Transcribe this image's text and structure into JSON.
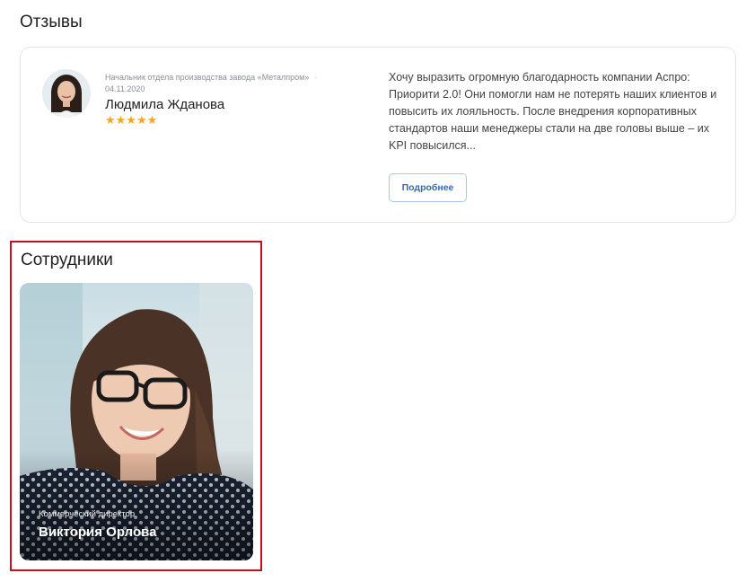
{
  "reviews": {
    "title": "Отзывы",
    "item": {
      "position": "Начальник отдела производства завода «Металпром»",
      "date": "04.11.2020",
      "name": "Людмила Жданова",
      "rating": 5,
      "rating_stars": "★★★★★",
      "text": "Хочу выразить огромную благодарность компании Аспро: Приорити 2.0! Они помогли нам не потерять наших клиентов и повысить их лояльность. После внедрения корпоративных стандартов наши менеджеры стали на две головы выше – их KPI повысился...",
      "more_label": "Подробнее"
    }
  },
  "staff": {
    "title": "Сотрудники",
    "employee": {
      "role": "Коммерческий директор",
      "name": "Виктория Орлова"
    }
  },
  "colors": {
    "accent": "#2d6bbd",
    "star": "#f5a623",
    "highlight": "#c1121f"
  }
}
